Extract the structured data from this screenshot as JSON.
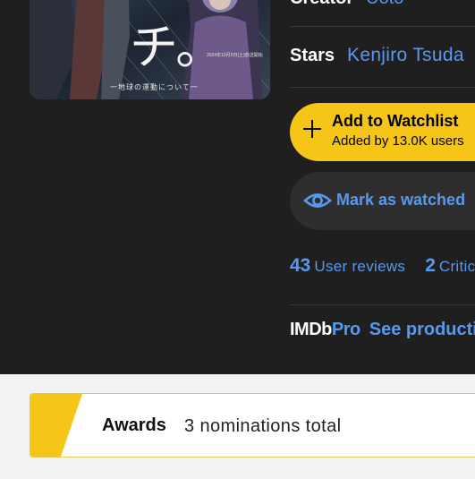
{
  "credits": {
    "creator_label": "Creator",
    "creator_value": "Uoto",
    "stars_label": "Stars",
    "stars_value": "Kenjiro Tsuda"
  },
  "actions": {
    "watchlist_title": "Add to Watchlist",
    "watchlist_sub": "Added by 13.0K users",
    "watched_label": "Mark as watched"
  },
  "reviews": {
    "user_count": "43",
    "user_label": "User reviews",
    "critic_count": "2",
    "critic_label": "Critic reviews"
  },
  "imdbpro": {
    "logo_imdb": "IMDb",
    "logo_pro": "Pro",
    "link": "See production info"
  },
  "awards": {
    "label": "Awards",
    "value": "3 nominations total"
  },
  "poster": {
    "kanji": "チ。",
    "subtitle": "一地球の運動について一",
    "date_line": "2024年10月5日(土)放送開始"
  },
  "colors": {
    "accent": "#f5c518",
    "link": "#5799ef",
    "background": "#1f1f1f"
  }
}
